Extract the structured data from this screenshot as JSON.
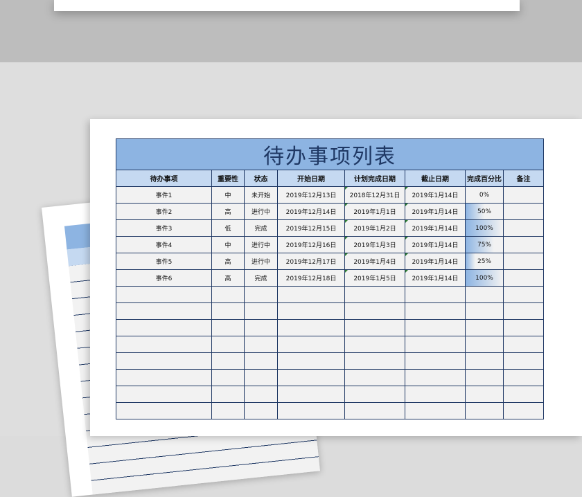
{
  "sheet": {
    "title": "待办事项列表",
    "headers": [
      "待办事项",
      "重要性",
      "状态",
      "开始日期",
      "计划完成日期",
      "截止日期",
      "完成百分比",
      "备注"
    ],
    "rows": [
      {
        "task": "事件1",
        "priority": "中",
        "status": "未开始",
        "start": "2019年12月13日",
        "planned": "2018年12月31日",
        "deadline": "2019年1月14日",
        "percent_label": "0%",
        "percent": 0,
        "note": ""
      },
      {
        "task": "事件2",
        "priority": "高",
        "status": "进行中",
        "start": "2019年12月14日",
        "planned": "2019年1月1日",
        "deadline": "2019年1月14日",
        "percent_label": "50%",
        "percent": 50,
        "note": ""
      },
      {
        "task": "事件3",
        "priority": "低",
        "status": "完成",
        "start": "2019年12月15日",
        "planned": "2019年1月2日",
        "deadline": "2019年1月14日",
        "percent_label": "100%",
        "percent": 100,
        "note": ""
      },
      {
        "task": "事件4",
        "priority": "中",
        "status": "进行中",
        "start": "2019年12月16日",
        "planned": "2019年1月3日",
        "deadline": "2019年1月14日",
        "percent_label": "75%",
        "percent": 75,
        "note": ""
      },
      {
        "task": "事件5",
        "priority": "高",
        "status": "进行中",
        "start": "2019年12月17日",
        "planned": "2019年1月4日",
        "deadline": "2019年1月14日",
        "percent_label": "25%",
        "percent": 25,
        "note": ""
      },
      {
        "task": "事件6",
        "priority": "高",
        "status": "完成",
        "start": "2019年12月18日",
        "planned": "2019年1月5日",
        "deadline": "2019年1月14日",
        "percent_label": "100%",
        "percent": 100,
        "note": ""
      }
    ],
    "empty_rows": 8,
    "colors": {
      "title_bg": "#8db4e2",
      "header_bg": "#c5d9f1",
      "cell_bg": "#f2f2f2",
      "border": "#1f3864"
    }
  }
}
